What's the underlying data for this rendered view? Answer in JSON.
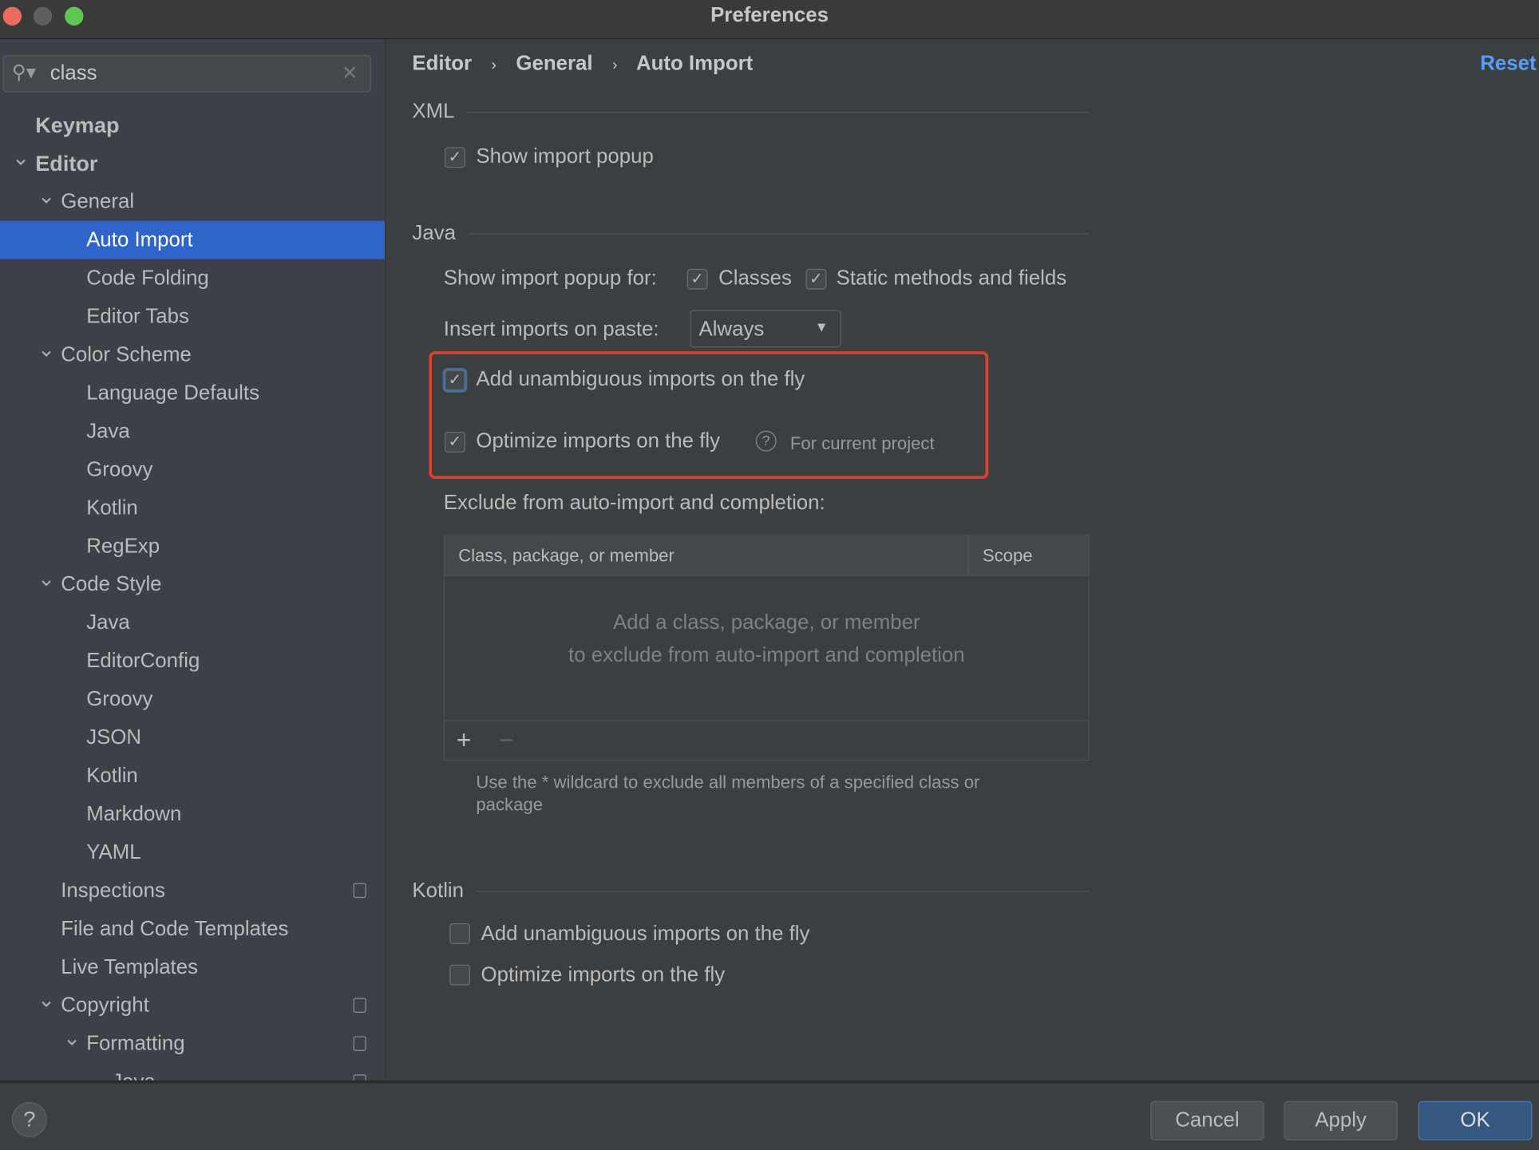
{
  "window": {
    "title": "Preferences",
    "traffic_lights": {
      "close": "#ed6a5e",
      "minimize": "#5f5f5f",
      "maximize": "#61c554"
    }
  },
  "search": {
    "value": "class",
    "icon": "search-icon",
    "clear_icon": "close-icon"
  },
  "sidebar": {
    "items": [
      {
        "label": "Keymap",
        "level": 0,
        "bold": true
      },
      {
        "label": "Editor",
        "level": 0,
        "bold": true,
        "expanded": true
      },
      {
        "label": "General",
        "level": 1,
        "expanded": true
      },
      {
        "label": "Auto Import",
        "level": 2,
        "selected": true
      },
      {
        "label": "Code Folding",
        "level": 2
      },
      {
        "label": "Editor Tabs",
        "level": 2
      },
      {
        "label": "Color Scheme",
        "level": 1,
        "expanded": true
      },
      {
        "label": "Language Defaults",
        "level": 2
      },
      {
        "label": "Java",
        "level": 2
      },
      {
        "label": "Groovy",
        "level": 2
      },
      {
        "label": "Kotlin",
        "level": 2
      },
      {
        "label": "RegExp",
        "level": 2
      },
      {
        "label": "Code Style",
        "level": 1,
        "expanded": true
      },
      {
        "label": "Java",
        "level": 2
      },
      {
        "label": "EditorConfig",
        "level": 2
      },
      {
        "label": "Groovy",
        "level": 2
      },
      {
        "label": "JSON",
        "level": 2
      },
      {
        "label": "Kotlin",
        "level": 2
      },
      {
        "label": "Markdown",
        "level": 2
      },
      {
        "label": "YAML",
        "level": 2
      },
      {
        "label": "Inspections",
        "level": 1,
        "badge": true
      },
      {
        "label": "File and Code Templates",
        "level": 1
      },
      {
        "label": "Live Templates",
        "level": 1
      },
      {
        "label": "Copyright",
        "level": 1,
        "expanded": true,
        "badge": true
      },
      {
        "label": "Formatting",
        "level": 2,
        "expanded": true,
        "badge": true
      },
      {
        "label": "Java",
        "level": 3,
        "badge": true
      }
    ]
  },
  "breadcrumb": [
    "Editor",
    "General",
    "Auto Import"
  ],
  "reset_label": "Reset",
  "xml": {
    "title": "XML",
    "show_import_popup": {
      "label": "Show import popup",
      "checked": true
    }
  },
  "java": {
    "title": "Java",
    "show_popup_for_label": "Show import popup for:",
    "classes": {
      "label": "Classes",
      "checked": true
    },
    "static": {
      "label": "Static methods and fields",
      "checked": true
    },
    "insert_on_paste_label": "Insert imports on paste:",
    "insert_on_paste_value": "Always",
    "add_unambiguous": {
      "label": "Add unambiguous imports on the fly",
      "checked": true
    },
    "optimize": {
      "label": "Optimize imports on the fly",
      "checked": true,
      "hint": "For current project"
    },
    "exclude_label": "Exclude from auto-import and completion:",
    "table": {
      "columns": [
        "Class, package, or member",
        "Scope"
      ],
      "empty_line1": "Add a class, package, or member",
      "empty_line2": "to exclude from auto-import and completion"
    },
    "wildcard_note_line1": "Use the * wildcard to exclude all members of a specified class or",
    "wildcard_note_line2": "package"
  },
  "kotlin": {
    "title": "Kotlin",
    "add_unambiguous": {
      "label": "Add unambiguous imports on the fly",
      "checked": false
    },
    "optimize": {
      "label": "Optimize imports on the fly",
      "checked": false
    }
  },
  "buttons": {
    "help": "?",
    "cancel": "Cancel",
    "apply": "Apply",
    "ok": "OK"
  },
  "colors": {
    "accent": "#2f65ca",
    "highlight_box": "#e0412c",
    "link": "#589df6",
    "ok_button": "#365880"
  }
}
